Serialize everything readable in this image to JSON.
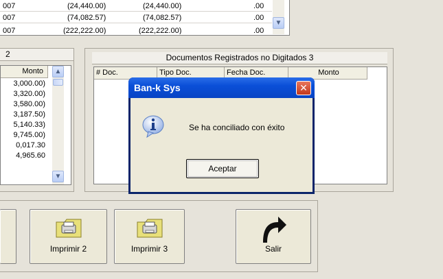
{
  "top_grid": {
    "rows": [
      {
        "c1": "007",
        "c2": "(24,440.00)",
        "c3": "(24,440.00)",
        "c4": ".00"
      },
      {
        "c1": "007",
        "c2": "(74,082.57)",
        "c3": "(74,082.57)",
        "c4": ".00"
      },
      {
        "c1": "007",
        "c2": "(222,222.00)",
        "c3": "(222,222.00)",
        "c4": ".00"
      }
    ]
  },
  "left_group": {
    "title": "2",
    "header_monto": "Monto",
    "rows": [
      "3,000.00)",
      "3,320.00)",
      "3,580.00)",
      "3,187.50)",
      "5,140.33)",
      "9,745.00)",
      "0,017.30",
      "4,965.60"
    ]
  },
  "right_group": {
    "title": "Documentos Registrados no Digitados 3",
    "headers": [
      "# Doc.",
      "Tipo Doc.",
      "Fecha Doc.",
      "Monto"
    ]
  },
  "buttons": {
    "imprimir2": "Imprimir 2",
    "imprimir3": "Imprimir 3",
    "salir": "Salir"
  },
  "dialog": {
    "title": "Ban-k Sys",
    "message": "Se ha conciliado con éxito",
    "ok": "Aceptar",
    "close": "✕"
  },
  "colors": {
    "dialog_title": "#0a4fd8",
    "close_button": "#d4462b",
    "window_bg": "#ece9d8"
  },
  "icons": [
    "info-icon",
    "printer-folder-icon",
    "exit-arrow-icon",
    "scroll-up-icon",
    "scroll-down-icon"
  ]
}
